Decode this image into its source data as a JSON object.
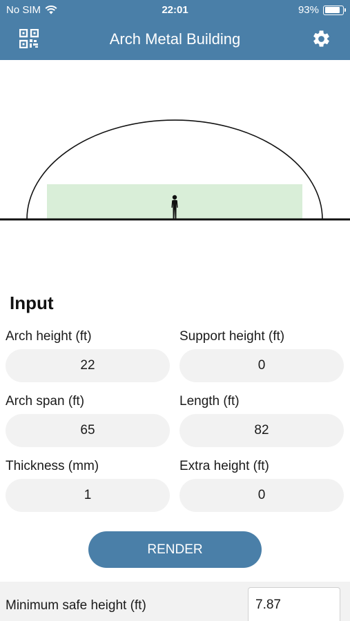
{
  "status_bar": {
    "carrier": "No SIM",
    "time": "22:01",
    "battery": "93%",
    "battery_level": 0.93,
    "icons": [
      "wifi-icon",
      "battery-icon"
    ]
  },
  "header": {
    "title": "Arch Metal Building",
    "left_icon": "qr-code-icon",
    "right_icon": "gear-icon",
    "background": "#4a7fa8"
  },
  "input": {
    "title": "Input",
    "fields": {
      "arch_height": {
        "label": "Arch height (ft)",
        "value": "22"
      },
      "support_height": {
        "label": "Support height (ft)",
        "value": "0"
      },
      "arch_span": {
        "label": "Arch span (ft)",
        "value": "65"
      },
      "length": {
        "label": "Length (ft)",
        "value": "82"
      },
      "thickness": {
        "label": "Thickness (mm)",
        "value": "1"
      },
      "extra_height": {
        "label": "Extra height (ft)",
        "value": "0"
      }
    }
  },
  "render_button": {
    "label": "RENDER"
  },
  "result": {
    "label": "Minimum safe height (ft)",
    "value": "7.87"
  },
  "colors": {
    "accent": "#4a7fa8",
    "safe_zone": "#d9eed8",
    "field_bg": "#f2f2f2"
  }
}
